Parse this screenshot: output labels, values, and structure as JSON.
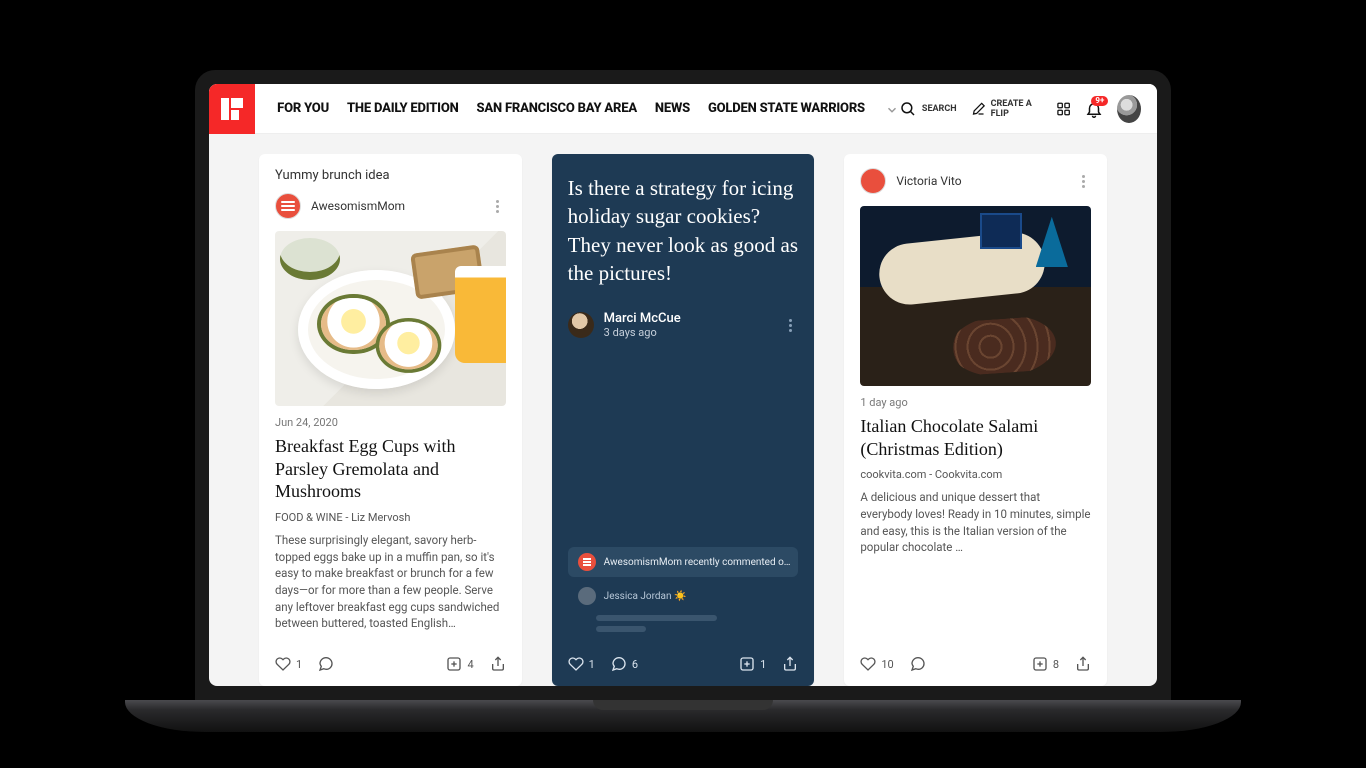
{
  "header": {
    "nav": {
      "for_you": "FOR YOU",
      "daily_edition": "THE DAILY EDITION",
      "sf_bay": "SAN FRANCISCO BAY AREA",
      "news": "NEWS",
      "warriors": "GOLDEN STATE WARRIORS"
    },
    "search_label": "SEARCH",
    "create_label": "CREATE A FLIP",
    "notification_count": "9+"
  },
  "cards": {
    "brunch": {
      "caption": "Yummy brunch idea",
      "author": "AwesomismMom",
      "date": "Jun 24, 2020",
      "title": "Breakfast Egg Cups with Parsley Gremolata and Mushrooms",
      "source": "FOOD & WINE - Liz Mervosh",
      "excerpt": "These surprisingly elegant, savory herb-topped eggs bake up in a muffin pan, so it's easy to make breakfast or brunch for a few days—or for more than a few people. Serve any leftover breakfast egg cups sandwiched between buttered, toasted English…",
      "likes": "1",
      "adds": "4"
    },
    "question": {
      "title": "Is there a strategy for icing holiday sugar cookies? They never look as good as the pictures!",
      "author": "Marci McCue",
      "time": "3 days ago",
      "comment_preview": "AwesomismMom recently commented o…",
      "commenter2": "Jessica Jordan ☀️",
      "likes": "1",
      "comments": "6",
      "adds": "1"
    },
    "salami": {
      "author": "Victoria Vito",
      "time": "1 day ago",
      "title": "Italian Chocolate Salami (Christmas Edition)",
      "source": "cookvita.com - Cookvita.com",
      "excerpt": "A delicious and unique dessert that everybody loves! Ready in 10 minutes, simple and easy, this is the Italian version of the popular chocolate …",
      "likes": "10",
      "adds": "8"
    }
  }
}
